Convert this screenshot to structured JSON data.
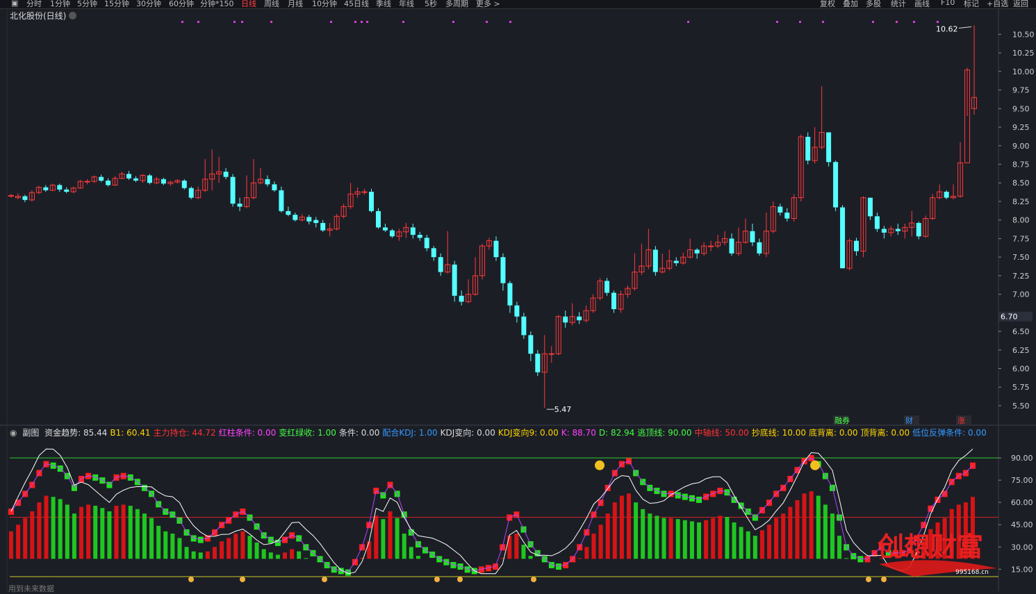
{
  "toolbar": {
    "periods": [
      "分时",
      "1分钟",
      "5分钟",
      "15分钟",
      "30分钟",
      "60分钟",
      "分钟*150",
      "日线",
      "周线",
      "月线",
      "10分钟",
      "45日线",
      "季线",
      "年线",
      "5秒",
      "多周期",
      "更多 >"
    ],
    "active_period": "日线",
    "right_buttons": [
      "复权",
      "叠加",
      "多股",
      "统计",
      "画线",
      "F10",
      "标记",
      "+自选",
      "返回"
    ]
  },
  "title": "北化股份(日线)",
  "price_axis": {
    "ticks": [
      "10.50",
      "10.25",
      "10.00",
      "9.75",
      "9.50",
      "9.25",
      "9.00",
      "8.75",
      "8.50",
      "8.25",
      "8.00",
      "7.75",
      "7.50",
      "7.25",
      "7.00",
      "6.70",
      "6.50",
      "6.25",
      "6.00",
      "5.75",
      "5.50"
    ],
    "current": "6.70"
  },
  "annotations": {
    "high": "10.62",
    "low": "5.47"
  },
  "badges": [
    "融券",
    "财",
    "涨"
  ],
  "sub_chart": {
    "name": "副图",
    "indicator": "资金趋势",
    "legend": [
      {
        "label": "资金趋势:",
        "value": "85.44",
        "color": "#dddddd"
      },
      {
        "label": "B1:",
        "value": "60.41",
        "color": "#ffd700"
      },
      {
        "label": "主力持仓:",
        "value": "44.72",
        "color": "#ff3333"
      },
      {
        "label": "红柱条件:",
        "value": "0.00",
        "color": "#ff44ff"
      },
      {
        "label": "变红绿收:",
        "value": "1.00",
        "color": "#44ff44"
      },
      {
        "label": "条件:",
        "value": "0.00",
        "color": "#dddddd"
      },
      {
        "label": "配合KDJ:",
        "value": "1.00",
        "color": "#3399ff"
      },
      {
        "label": "KDJ变向:",
        "value": "0.00",
        "color": "#dddddd"
      },
      {
        "label": "KDJ变向9:",
        "value": "0.00",
        "color": "#ffd700"
      },
      {
        "label": "K:",
        "value": "88.70",
        "color": "#ff44ff"
      },
      {
        "label": "D:",
        "value": "82.94",
        "color": "#44ff44"
      },
      {
        "label": "逃顶线:",
        "value": "90.00",
        "color": "#44ff44"
      },
      {
        "label": "中轴线:",
        "value": "50.00",
        "color": "#ff3333"
      },
      {
        "label": "抄底线:",
        "value": "10.00",
        "color": "#ffd700"
      },
      {
        "label": "底背离:",
        "value": "0.00",
        "color": "#ffd700"
      },
      {
        "label": "顶背离:",
        "value": "0.00",
        "color": "#ffd700"
      },
      {
        "label": "低位反弹条件:",
        "value": "0.00",
        "color": "#3399ff"
      }
    ],
    "axis": [
      "90.00",
      "75.00",
      "60.00",
      "45.00",
      "30.00",
      "15.00"
    ]
  },
  "watermark": {
    "text": "创想财富",
    "url": "995168.cn"
  },
  "bottom_note": "用到未来数据",
  "colors": {
    "up": "#ff3b3b",
    "down": "#54ffff",
    "bg": "#1c1e26"
  },
  "chart_data": {
    "type": "candlestick",
    "title": "北化股份(日线)",
    "ylim": [
      5.35,
      10.7
    ],
    "candles": [
      [
        8.33,
        8.33,
        8.35,
        8.3
      ],
      [
        8.3,
        8.32,
        8.36,
        8.28
      ],
      [
        8.32,
        8.27,
        8.34,
        8.24
      ],
      [
        8.27,
        8.37,
        8.4,
        8.25
      ],
      [
        8.37,
        8.44,
        8.46,
        8.35
      ],
      [
        8.44,
        8.4,
        8.47,
        8.38
      ],
      [
        8.4,
        8.47,
        8.49,
        8.39
      ],
      [
        8.47,
        8.41,
        8.49,
        8.38
      ],
      [
        8.41,
        8.38,
        8.44,
        8.36
      ],
      [
        8.38,
        8.43,
        8.45,
        8.36
      ],
      [
        8.43,
        8.52,
        8.54,
        8.42
      ],
      [
        8.52,
        8.52,
        8.55,
        8.48
      ],
      [
        8.52,
        8.58,
        8.6,
        8.5
      ],
      [
        8.58,
        8.53,
        8.61,
        8.51
      ],
      [
        8.53,
        8.47,
        8.56,
        8.45
      ],
      [
        8.47,
        8.56,
        8.59,
        8.46
      ],
      [
        8.56,
        8.62,
        8.65,
        8.55
      ],
      [
        8.62,
        8.56,
        8.66,
        8.54
      ],
      [
        8.56,
        8.53,
        8.59,
        8.51
      ],
      [
        8.53,
        8.6,
        8.62,
        8.5
      ],
      [
        8.6,
        8.5,
        8.62,
        8.48
      ],
      [
        8.5,
        8.55,
        8.58,
        8.48
      ],
      [
        8.55,
        8.49,
        8.57,
        8.47
      ],
      [
        8.49,
        8.51,
        8.53,
        8.46
      ],
      [
        8.51,
        8.53,
        8.55,
        8.49
      ],
      [
        8.53,
        8.43,
        8.55,
        8.41
      ],
      [
        8.43,
        8.3,
        8.45,
        8.28
      ],
      [
        8.3,
        8.4,
        8.45,
        8.28
      ],
      [
        8.4,
        8.55,
        8.82,
        8.38
      ],
      [
        8.55,
        8.62,
        8.95,
        8.4
      ],
      [
        8.62,
        8.65,
        8.85,
        8.5
      ],
      [
        8.65,
        8.58,
        8.7,
        8.55
      ],
      [
        8.58,
        8.22,
        8.62,
        8.18
      ],
      [
        8.22,
        8.18,
        8.3,
        8.12
      ],
      [
        8.18,
        8.3,
        8.6,
        8.16
      ],
      [
        8.3,
        8.5,
        8.82,
        8.28
      ],
      [
        8.5,
        8.55,
        8.7,
        8.48
      ],
      [
        8.55,
        8.48,
        8.6,
        8.45
      ],
      [
        8.48,
        8.4,
        8.52,
        8.38
      ],
      [
        8.4,
        8.12,
        8.45,
        8.1
      ],
      [
        8.12,
        8.07,
        8.18,
        8.05
      ],
      [
        8.07,
        8.0,
        8.1,
        7.98
      ],
      [
        8.0,
        8.04,
        8.08,
        7.98
      ],
      [
        8.04,
        7.98,
        8.07,
        7.94
      ],
      [
        8.0,
        7.96,
        8.04,
        7.9
      ],
      [
        7.96,
        7.86,
        8.0,
        7.84
      ],
      [
        7.86,
        7.88,
        7.96,
        7.78
      ],
      [
        7.88,
        8.05,
        8.08,
        7.86
      ],
      [
        8.05,
        8.18,
        8.22,
        8.02
      ],
      [
        8.18,
        8.35,
        8.5,
        8.15
      ],
      [
        8.35,
        8.38,
        8.44,
        8.3
      ],
      [
        8.38,
        8.38,
        8.42,
        8.34
      ],
      [
        8.38,
        8.12,
        8.42,
        8.1
      ],
      [
        8.12,
        7.9,
        8.16,
        7.88
      ],
      [
        7.9,
        7.86,
        7.95,
        7.84
      ],
      [
        7.86,
        7.78,
        7.88,
        7.76
      ],
      [
        7.78,
        7.84,
        7.88,
        7.72
      ],
      [
        7.84,
        7.9,
        7.96,
        7.76
      ],
      [
        7.9,
        7.8,
        7.95,
        7.75
      ],
      [
        7.8,
        7.76,
        7.84,
        7.72
      ],
      [
        7.76,
        7.62,
        7.8,
        7.58
      ],
      [
        7.62,
        7.5,
        7.65,
        7.45
      ],
      [
        7.5,
        7.3,
        7.55,
        7.25
      ],
      [
        7.3,
        7.4,
        7.85,
        7.28
      ],
      [
        7.4,
        6.98,
        7.45,
        6.9
      ],
      [
        6.98,
        6.9,
        7.05,
        6.85
      ],
      [
        6.9,
        7.0,
        7.2,
        6.88
      ],
      [
        7.0,
        7.25,
        7.5,
        6.98
      ],
      [
        7.25,
        7.65,
        7.68,
        7.2
      ],
      [
        7.65,
        7.72,
        7.76,
        7.6
      ],
      [
        7.72,
        7.5,
        7.78,
        7.45
      ],
      [
        7.5,
        7.15,
        7.55,
        7.05
      ],
      [
        7.15,
        6.85,
        7.18,
        6.75
      ],
      [
        6.85,
        6.7,
        6.9,
        6.62
      ],
      [
        6.7,
        6.45,
        6.75,
        6.4
      ],
      [
        6.45,
        6.2,
        6.5,
        6.1
      ],
      [
        6.2,
        5.95,
        6.25,
        5.9
      ],
      [
        5.95,
        6.2,
        6.45,
        5.47
      ],
      [
        6.2,
        6.2,
        6.3,
        6.08
      ],
      [
        6.2,
        6.7,
        6.72,
        6.18
      ],
      [
        6.7,
        6.62,
        6.78,
        6.55
      ],
      [
        6.62,
        6.7,
        6.88,
        6.58
      ],
      [
        6.7,
        6.65,
        6.76,
        6.6
      ],
      [
        6.65,
        6.78,
        6.85,
        6.62
      ],
      [
        6.78,
        6.95,
        7.0,
        6.75
      ],
      [
        6.95,
        7.18,
        7.22,
        6.92
      ],
      [
        7.18,
        7.02,
        7.22,
        6.98
      ],
      [
        7.02,
        6.8,
        7.05,
        6.75
      ],
      [
        6.8,
        7.0,
        7.05,
        6.75
      ],
      [
        7.0,
        7.08,
        7.12,
        6.95
      ],
      [
        7.08,
        7.3,
        7.55,
        7.05
      ],
      [
        7.3,
        7.38,
        7.68,
        7.26
      ],
      [
        7.38,
        7.6,
        7.88,
        7.34
      ],
      [
        7.6,
        7.3,
        7.65,
        7.25
      ],
      [
        7.3,
        7.35,
        7.55,
        7.28
      ],
      [
        7.35,
        7.45,
        7.6,
        7.32
      ],
      [
        7.45,
        7.42,
        7.5,
        7.38
      ],
      [
        7.42,
        7.5,
        7.56,
        7.4
      ],
      [
        7.5,
        7.6,
        7.75,
        7.48
      ],
      [
        7.6,
        7.55,
        7.62,
        7.48
      ],
      [
        7.55,
        7.65,
        7.7,
        7.52
      ],
      [
        7.65,
        7.65,
        7.72,
        7.58
      ],
      [
        7.65,
        7.7,
        7.8,
        7.62
      ],
      [
        7.7,
        7.75,
        7.85,
        7.66
      ],
      [
        7.75,
        7.55,
        7.82,
        7.52
      ],
      [
        7.55,
        7.7,
        7.9,
        7.52
      ],
      [
        7.7,
        7.85,
        8.02,
        7.68
      ],
      [
        7.85,
        7.7,
        7.95,
        7.65
      ],
      [
        7.7,
        7.55,
        7.75,
        7.52
      ],
      [
        7.55,
        7.85,
        8.1,
        7.5
      ],
      [
        7.85,
        8.18,
        8.25,
        7.82
      ],
      [
        8.18,
        8.1,
        8.22,
        8.06
      ],
      [
        8.1,
        8.02,
        8.16,
        7.98
      ],
      [
        8.02,
        8.3,
        8.35,
        7.98
      ],
      [
        8.3,
        9.12,
        9.15,
        8.25
      ],
      [
        9.12,
        8.8,
        9.18,
        8.75
      ],
      [
        8.8,
        8.98,
        9.25,
        8.76
      ],
      [
        8.98,
        9.18,
        9.8,
        8.95
      ],
      [
        9.18,
        8.78,
        9.12,
        8.72
      ],
      [
        8.78,
        8.17,
        8.8,
        8.12
      ],
      [
        8.17,
        7.35,
        8.2,
        7.35
      ],
      [
        7.35,
        7.72,
        7.75,
        7.32
      ],
      [
        7.72,
        7.58,
        7.76,
        7.52
      ],
      [
        7.58,
        8.3,
        8.32,
        7.5
      ],
      [
        8.3,
        8.05,
        8.2,
        8.0
      ],
      [
        8.05,
        7.88,
        8.1,
        7.84
      ],
      [
        7.88,
        7.83,
        7.92,
        7.75
      ],
      [
        7.83,
        7.88,
        7.92,
        7.78
      ],
      [
        7.88,
        7.85,
        7.95,
        7.8
      ],
      [
        7.85,
        7.9,
        7.95,
        7.75
      ],
      [
        7.9,
        7.96,
        8.12,
        7.78
      ],
      [
        7.96,
        7.78,
        7.98,
        7.74
      ],
      [
        7.78,
        8.02,
        8.06,
        7.76
      ],
      [
        8.02,
        8.3,
        8.35,
        8.0
      ],
      [
        8.3,
        8.38,
        8.48,
        8.28
      ],
      [
        8.38,
        8.3,
        8.4,
        8.28
      ],
      [
        8.3,
        8.32,
        8.48,
        8.28
      ],
      [
        8.32,
        8.77,
        9.05,
        8.3
      ],
      [
        8.77,
        10.02,
        10.05,
        9.4
      ],
      [
        9.5,
        9.65,
        10.62,
        9.42
      ]
    ],
    "sub_series": {
      "ylim": [
        10,
        98
      ],
      "funds": [
        54,
        60,
        66,
        72,
        80,
        86,
        85,
        83,
        78,
        70,
        76,
        78,
        77,
        75,
        72,
        77,
        78,
        77,
        74,
        70,
        66,
        59,
        54,
        52,
        48,
        40,
        36,
        35,
        36,
        40,
        45,
        48,
        52,
        54,
        50,
        44,
        38,
        35,
        33,
        35,
        38,
        36,
        30,
        26,
        22,
        18,
        15,
        14,
        13,
        20,
        30,
        45,
        68,
        65,
        72,
        66,
        52,
        40,
        32,
        28,
        25,
        22,
        20,
        18,
        17,
        15,
        14,
        15,
        16,
        17,
        30,
        50,
        52,
        42,
        32,
        26,
        22,
        18,
        17,
        18,
        22,
        30,
        40,
        52,
        60,
        70,
        80,
        86,
        88,
        80,
        74,
        70,
        68,
        66,
        66,
        65,
        64,
        63,
        62,
        64,
        66,
        68,
        67,
        62,
        58,
        54,
        50,
        55,
        60,
        66,
        70,
        76,
        82,
        88,
        90,
        86,
        78,
        70,
        50,
        30,
        24,
        22,
        22,
        26,
        30,
        26,
        26,
        26,
        28,
        36,
        45,
        56,
        62,
        66,
        74,
        78,
        80,
        85
      ]
    }
  }
}
